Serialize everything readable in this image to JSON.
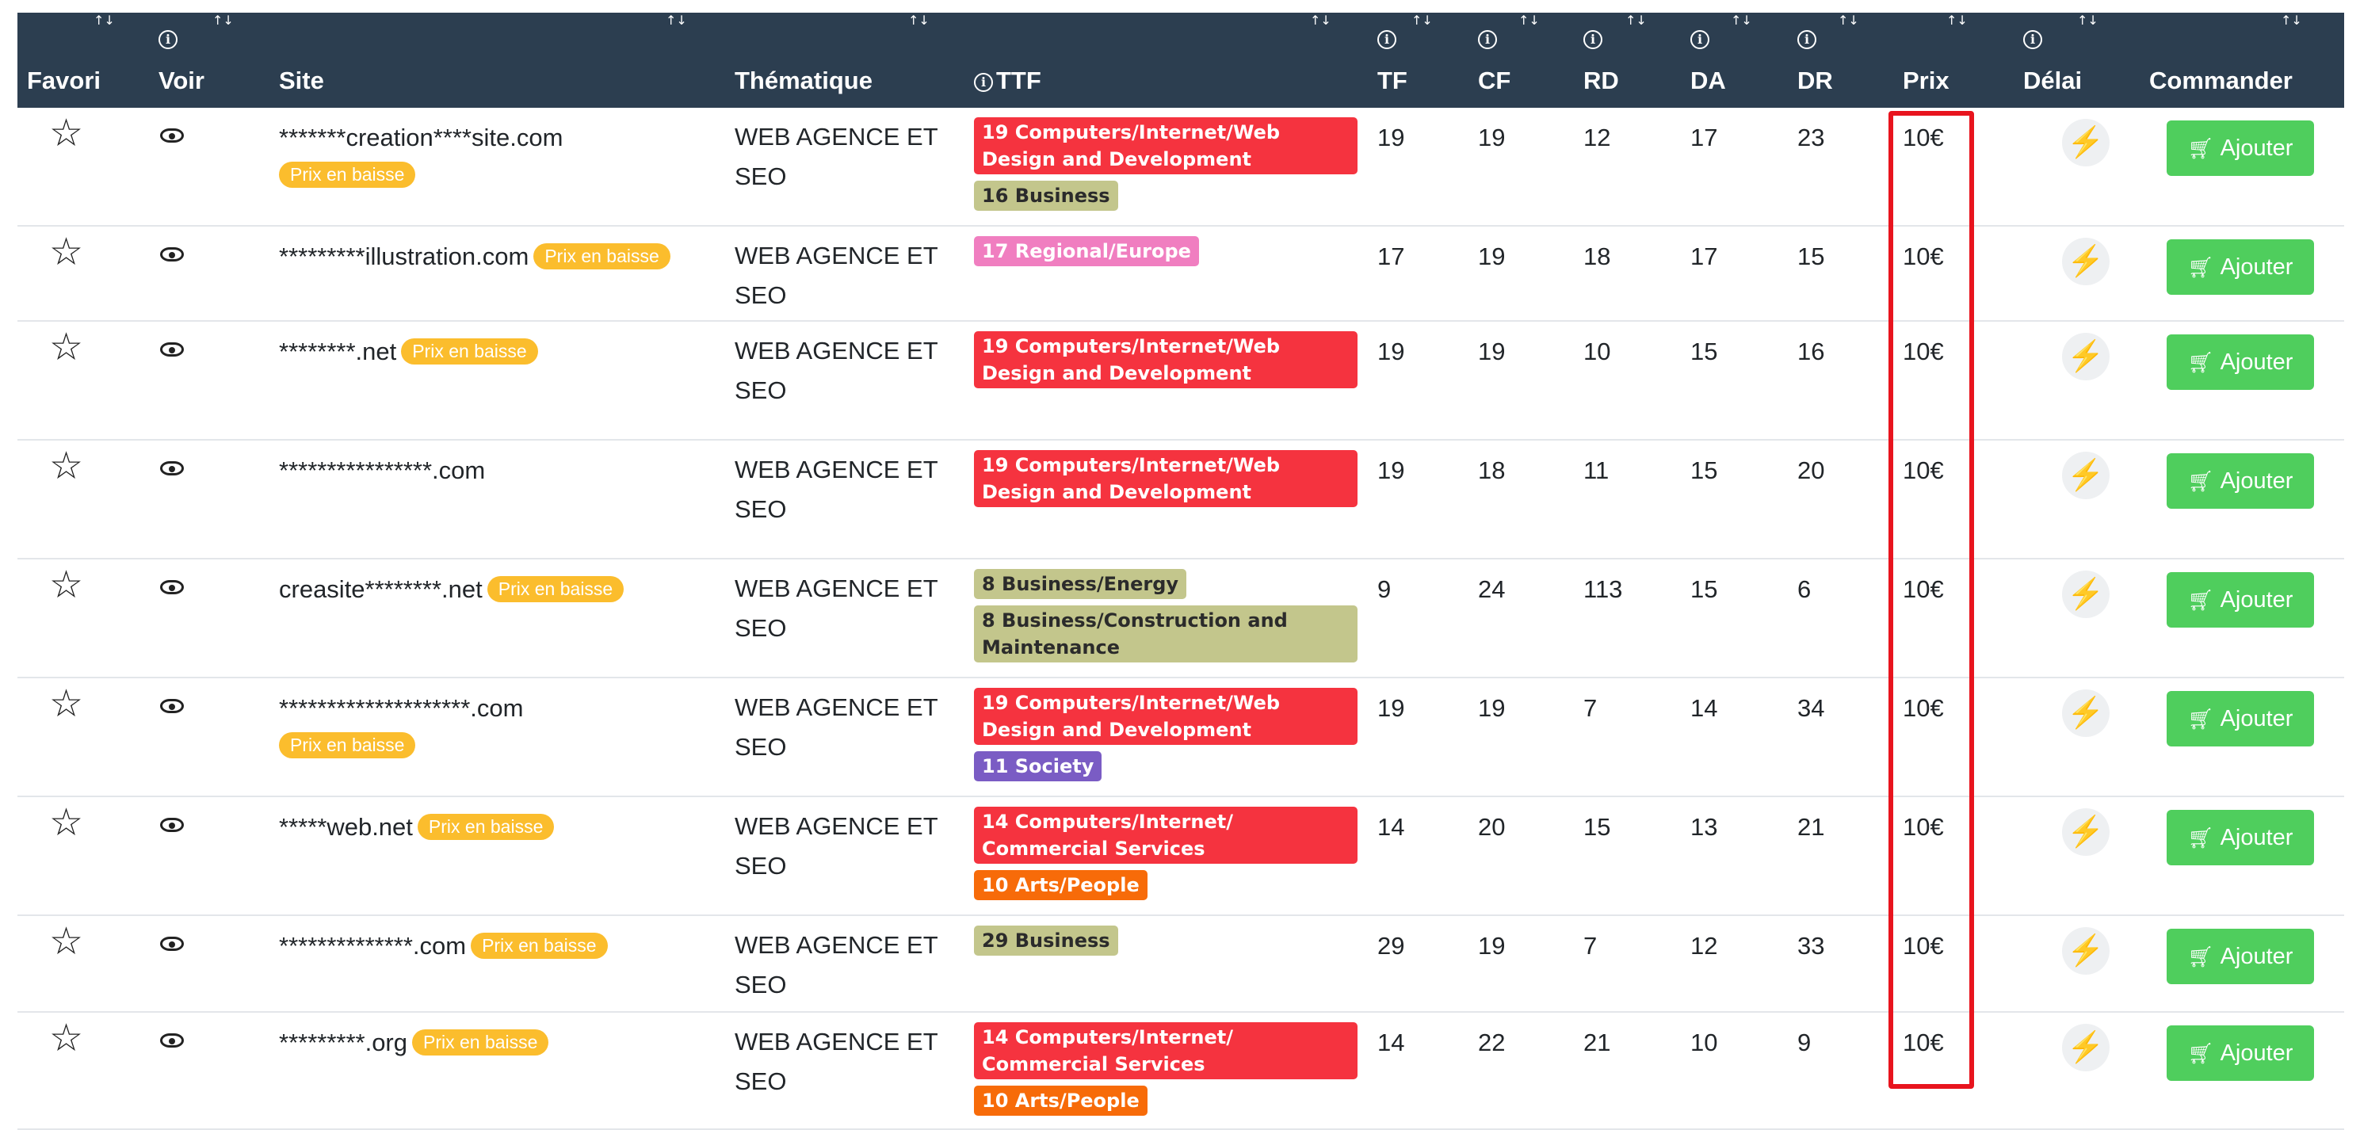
{
  "header": {
    "columns": [
      {
        "key": "favori",
        "label": "Favori",
        "info": false,
        "sort": "↑↓"
      },
      {
        "key": "voir",
        "label": "Voir",
        "info": true,
        "sort": "↑↓"
      },
      {
        "key": "site",
        "label": "Site",
        "info": false,
        "sort": "↑↓"
      },
      {
        "key": "thematique",
        "label": "Thématique",
        "info": false,
        "sort": "↑↓"
      },
      {
        "key": "ttf",
        "label": "TTF",
        "info": true,
        "sort": "↑↓"
      },
      {
        "key": "tf",
        "label": "TF",
        "info": true,
        "sort": "↑↓"
      },
      {
        "key": "cf",
        "label": "CF",
        "info": true,
        "sort": "↑↓"
      },
      {
        "key": "rd",
        "label": "RD",
        "info": true,
        "sort": "↑↓"
      },
      {
        "key": "da",
        "label": "DA",
        "info": true,
        "sort": "↑↓"
      },
      {
        "key": "dr",
        "label": "DR",
        "info": true,
        "sort": "↑↓"
      },
      {
        "key": "prix",
        "label": "Prix",
        "info": false,
        "sort": "↑↓"
      },
      {
        "key": "delai",
        "label": "Délai",
        "info": true,
        "sort": "↑↓"
      },
      {
        "key": "commander",
        "label": "Commander",
        "info": false,
        "sort": "↑↓"
      }
    ],
    "info_glyph": "i",
    "active_sort_column": "prix"
  },
  "promo_label": "Prix en baisse",
  "add_button_label": "Ajouter",
  "icons": {
    "favorite": "star-outline-icon",
    "view": "eye-icon",
    "delay": "lightning-bolt-icon",
    "cart": "cart-icon"
  },
  "colors": {
    "header_bg": "#2c3e50",
    "promo_badge": "#fbbd2d",
    "add_button": "#4fce5d",
    "highlight": "#e8141e",
    "ttf_computers": "#f5333f",
    "ttf_business": "#c3c68c",
    "ttf_regional": "#f07ec0",
    "ttf_society": "#7a5cc4",
    "ttf_arts": "#f76b09"
  },
  "rows": [
    {
      "site": "*******creation****site.com",
      "promo": "block",
      "theme": "WEB AGENCE ET SEO",
      "ttf": [
        {
          "label": "19 Computers/Internet/Web Design and Development",
          "color": "#f5333f",
          "wide": true
        },
        {
          "label": "16 Business",
          "color": "#c3c68c",
          "dark": true
        }
      ],
      "tf": "19",
      "cf": "19",
      "rd": "12",
      "da": "17",
      "dr": "23",
      "prix": "10€"
    },
    {
      "site": "*********illustration.com",
      "promo": "inline",
      "theme": "WEB AGENCE ET SEO",
      "ttf": [
        {
          "label": "17 Regional/Europe",
          "color": "#f07ec0"
        }
      ],
      "tf": "17",
      "cf": "19",
      "rd": "18",
      "da": "17",
      "dr": "15",
      "prix": "10€"
    },
    {
      "site": "********.net",
      "promo": "inline",
      "theme": "WEB AGENCE ET SEO",
      "ttf": [
        {
          "label": "19 Computers/Internet/Web Design and Development",
          "color": "#f5333f",
          "wide": true
        }
      ],
      "tf": "19",
      "cf": "19",
      "rd": "10",
      "da": "15",
      "dr": "16",
      "prix": "10€"
    },
    {
      "site": "****************.com",
      "promo": "none",
      "theme": "WEB AGENCE ET SEO",
      "ttf": [
        {
          "label": "19 Computers/Internet/Web Design and Development",
          "color": "#f5333f",
          "wide": true
        }
      ],
      "tf": "19",
      "cf": "18",
      "rd": "11",
      "da": "15",
      "dr": "20",
      "prix": "10€"
    },
    {
      "site": "creasite********.net",
      "promo": "inline",
      "theme": "WEB AGENCE ET SEO",
      "ttf": [
        {
          "label": "8 Business/Energy",
          "color": "#c3c68c",
          "dark": true
        },
        {
          "label": "8 Business/Construction and Maintenance",
          "color": "#c3c68c",
          "dark": true,
          "wide": true
        }
      ],
      "tf": "9",
      "cf": "24",
      "rd": "113",
      "da": "15",
      "dr": "6",
      "prix": "10€"
    },
    {
      "site": "********************.com",
      "promo": "block",
      "theme": "WEB AGENCE ET SEO",
      "ttf": [
        {
          "label": "19 Computers/Internet/Web Design and Development",
          "color": "#f5333f",
          "wide": true
        },
        {
          "label": "11 Society",
          "color": "#7a5cc4"
        }
      ],
      "tf": "19",
      "cf": "19",
      "rd": "7",
      "da": "14",
      "dr": "34",
      "prix": "10€"
    },
    {
      "site": "*****web.net",
      "promo": "inline",
      "theme": "WEB AGENCE ET SEO",
      "ttf": [
        {
          "label": "14 Computers/Internet/ Commercial Services",
          "color": "#f5333f",
          "wide": true
        },
        {
          "label": "10 Arts/People",
          "color": "#f76b09"
        }
      ],
      "tf": "14",
      "cf": "20",
      "rd": "15",
      "da": "13",
      "dr": "21",
      "prix": "10€"
    },
    {
      "site": "**************.com",
      "promo": "inline",
      "theme": "WEB AGENCE ET SEO",
      "ttf": [
        {
          "label": "29 Business",
          "color": "#c3c68c",
          "dark": true
        }
      ],
      "tf": "29",
      "cf": "19",
      "rd": "7",
      "da": "12",
      "dr": "33",
      "prix": "10€"
    },
    {
      "site": "*********.org",
      "promo": "inline",
      "theme": "WEB AGENCE ET SEO",
      "ttf": [
        {
          "label": "14 Computers/Internet/ Commercial Services",
          "color": "#f5333f",
          "wide": true
        },
        {
          "label": "10 Arts/People",
          "color": "#f76b09"
        }
      ],
      "tf": "14",
      "cf": "22",
      "rd": "21",
      "da": "10",
      "dr": "9",
      "prix": "10€"
    }
  ]
}
